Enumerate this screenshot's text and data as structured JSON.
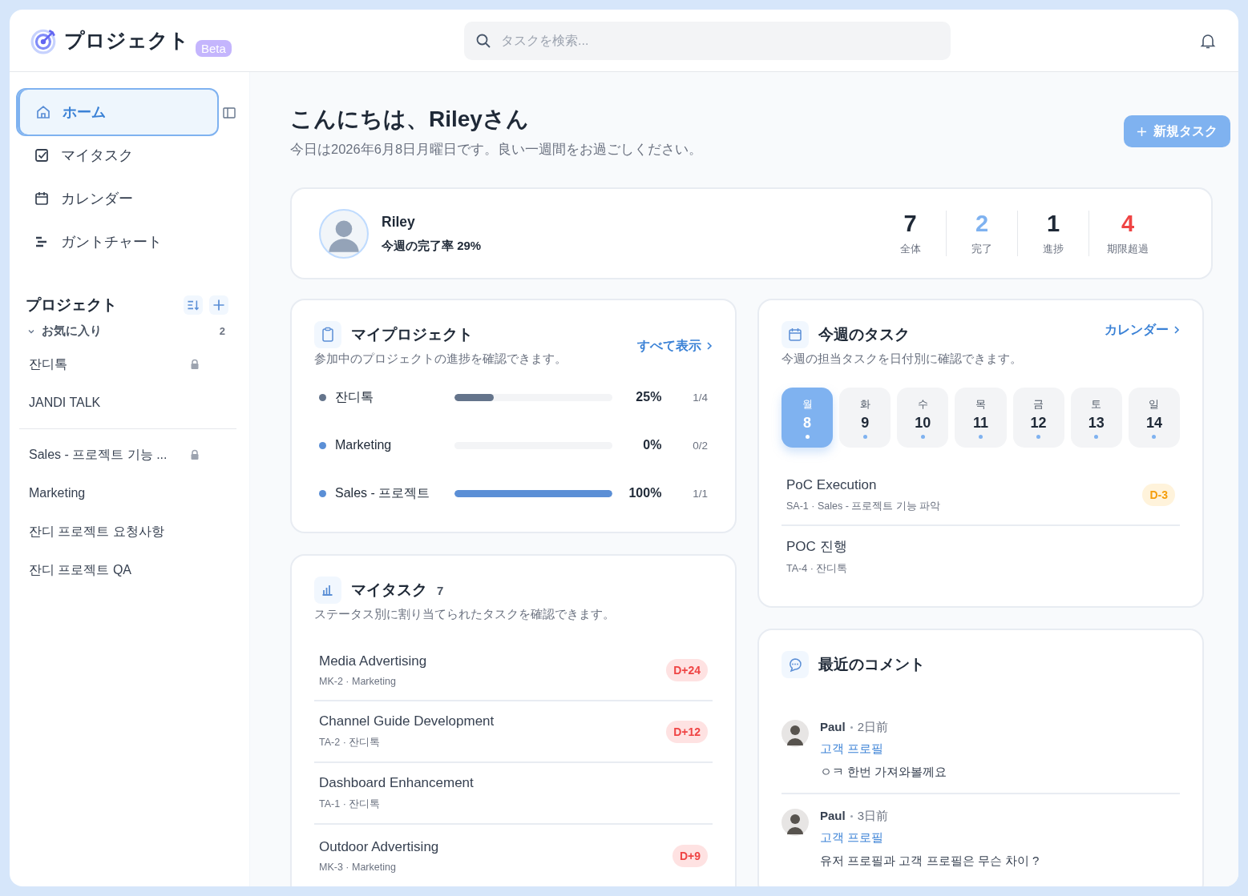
{
  "header": {
    "app_name": "プロジェクト",
    "badge": "Beta",
    "search": {
      "placeholder": "タスクを検索..."
    }
  },
  "sidebar": {
    "nav": [
      {
        "label": "ホーム",
        "selected": true
      },
      {
        "label": "マイタスク",
        "selected": false
      },
      {
        "label": "カレンダー",
        "selected": false
      },
      {
        "label": "ガントチャート",
        "selected": false
      }
    ],
    "projects_title": "プロジェクト",
    "favorites": {
      "label": "お気に入り",
      "count": "2",
      "expanded": true,
      "items": [
        {
          "name": "잔디톡",
          "locked": true
        },
        {
          "name": "JANDI TALK",
          "locked": false
        }
      ]
    },
    "projects": [
      {
        "name": "Sales - 프로젝트 기능 ...",
        "locked": true
      },
      {
        "name": "Marketing",
        "locked": false
      },
      {
        "name": "잔디 프로젝트 요청사항",
        "locked": false
      },
      {
        "name": "잔디 프로젝트 QA",
        "locked": false
      }
    ]
  },
  "greeting": {
    "title": "こんにちは、Rileyさん",
    "subtitle": "今日は2026年6月8日月曜日です。良い一週間をお過ごしください。",
    "new_task_button": "新規タスク"
  },
  "profile": {
    "name": "Riley",
    "completion": "今週の完了率 29%",
    "stats": [
      {
        "value": "7",
        "label": "全体",
        "color": "#1f2937"
      },
      {
        "value": "2",
        "label": "完了",
        "color": "#7fb2f0"
      },
      {
        "value": "1",
        "label": "進捗",
        "color": "#1f2937"
      },
      {
        "value": "4",
        "label": "期限超過",
        "color": "#ef4444"
      }
    ]
  },
  "my_projects": {
    "title": "マイプロジェクト",
    "link": "すべて表示",
    "subtitle": "参加中のプロジェクトの進捗を確認できます。",
    "items": [
      {
        "name": "잔디톡",
        "color": "#64748b",
        "level": 0.25,
        "percent": "25%",
        "ratio": "1/4"
      },
      {
        "name": "Marketing",
        "color": "#5b8fd6",
        "percent": "0%",
        "ratio": "0/2"
      },
      {
        "name": "Sales - 프로젝트",
        "color": "#5b8fd6",
        "level": 1,
        "percent": "100%",
        "ratio": "1/1"
      }
    ]
  },
  "my_tasks": {
    "title": "マイタスク",
    "count": "7",
    "subtitle": "ステータス別に割り当てられたタスクを確認できます。",
    "items": [
      {
        "title": "Media Advertising",
        "meta": "MK-2 · Marketing",
        "due": "D+24",
        "kind": "overdue"
      },
      {
        "title": "Channel Guide Development",
        "meta": "TA-2 · 잔디톡",
        "due": "D+12",
        "kind": "overdue"
      },
      {
        "title": "Dashboard Enhancement",
        "meta": "TA-1 · 잔디톡"
      },
      {
        "title": "Outdoor Advertising",
        "meta": "MK-3 · Marketing",
        "due": "D+9",
        "kind": "overdue"
      }
    ]
  },
  "week_tasks": {
    "title": "今週のタスク",
    "link": "カレンダー",
    "subtitle": "今週の担当タスクを日付別に確認できます。",
    "days": [
      {
        "weekday": "월",
        "date": "8",
        "selected": true
      },
      {
        "weekday": "화",
        "date": "9",
        "selected": false
      },
      {
        "weekday": "수",
        "date": "10",
        "selected": false
      },
      {
        "weekday": "목",
        "date": "11",
        "selected": false
      },
      {
        "weekday": "금",
        "date": "12",
        "selected": false
      },
      {
        "weekday": "토",
        "date": "13",
        "selected": false
      },
      {
        "weekday": "일",
        "date": "14",
        "selected": false
      }
    ],
    "items": [
      {
        "title": "PoC Execution",
        "meta": "SA-1 · Sales - 프로젝트 기능 파악",
        "due": "D-3",
        "kind": "upcoming"
      },
      {
        "title": "POC 진행",
        "meta": "TA-4 · 잔디톡"
      }
    ]
  },
  "comments": {
    "title": "最近のコメント",
    "items": [
      {
        "author": "Paul",
        "time": "2日前",
        "target": "고객 프로필",
        "text": "ㅇㅋ 한번 가져와볼께요"
      },
      {
        "author": "Paul",
        "time": "3日前",
        "target": "고객 프로필",
        "text": "유저 프로필과 고객 프로필은 무슨 차이 ?"
      }
    ]
  }
}
